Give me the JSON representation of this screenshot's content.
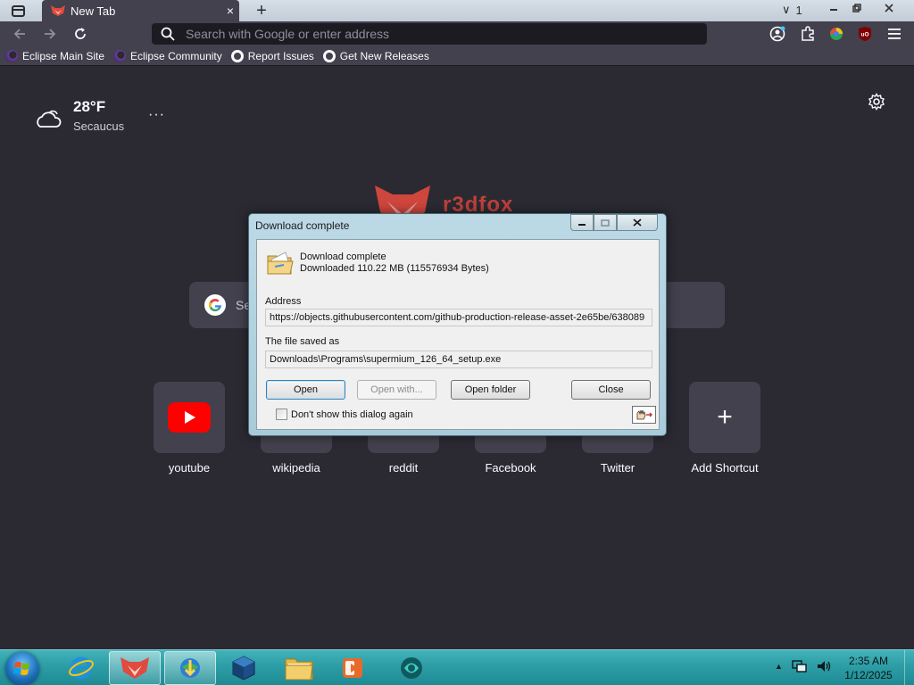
{
  "browser": {
    "tab": {
      "title": "New Tab",
      "close_glyph": "×"
    },
    "new_tab_glyph": "+",
    "tab_overflow": {
      "glyph": "∨",
      "count": "1"
    },
    "urlbar": {
      "placeholder": "Search with Google or enter address"
    },
    "bookmarks": [
      {
        "label": "Eclipse Main Site",
        "icon": "eclipse-icon"
      },
      {
        "label": "Eclipse Community",
        "icon": "eclipse-icon"
      },
      {
        "label": "Report Issues",
        "icon": "github-icon"
      },
      {
        "label": "Get New Releases",
        "icon": "github-icon"
      }
    ]
  },
  "newtab": {
    "weather": {
      "temp": "28°F",
      "city": "Secaucus",
      "more_glyph": "···"
    },
    "brand_text": "r3dfox",
    "search_placeholder": "Se",
    "shortcuts": [
      {
        "label": "youtube"
      },
      {
        "label": "wikipedia"
      },
      {
        "label": "reddit"
      },
      {
        "label": "Facebook"
      },
      {
        "label": "Twitter"
      },
      {
        "label": "Add Shortcut",
        "glyph": "+"
      }
    ]
  },
  "dialog": {
    "title": "Download complete",
    "heading": "Download complete",
    "downloaded": "Downloaded 110.22  MB (115576934 Bytes)",
    "address_label": "Address",
    "address_value": "https://objects.githubusercontent.com/github-production-release-asset-2e65be/638089",
    "saved_label": "The file saved as",
    "saved_value": "Downloads\\Programs\\supermium_126_64_setup.exe",
    "buttons": {
      "open": "Open",
      "open_with": "Open with...",
      "open_folder": "Open folder",
      "close": "Close"
    },
    "checkbox_label": "Don't show this dialog again"
  },
  "taskbar": {
    "time": "2:35 AM",
    "date": "1/12/2025",
    "tray_expand_glyph": "▲"
  },
  "colors": {
    "browser_bg": "#2b2a33",
    "toolbar": "#42414d",
    "accent_red": "#c8423a",
    "taskbar_teal": "#2d9ea6"
  }
}
